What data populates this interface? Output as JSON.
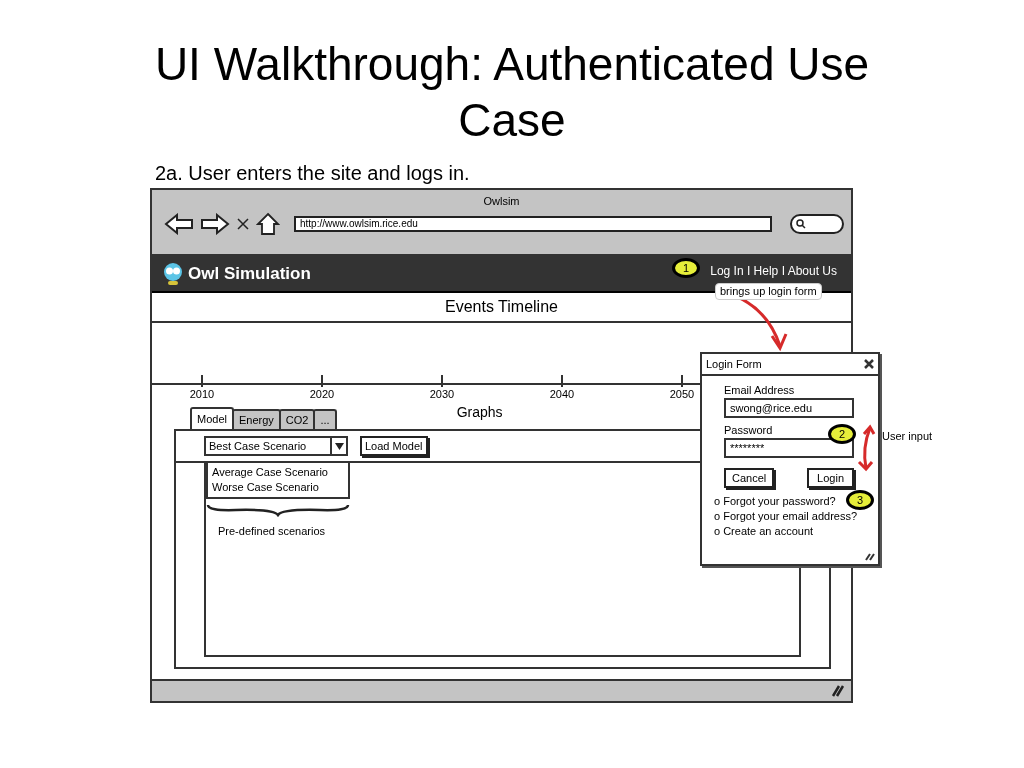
{
  "slide": {
    "title": "UI Walkthrough: Authenticated Use Case",
    "caption": "2a. User enters the site and logs in."
  },
  "browser": {
    "title": "Owlsim",
    "url": "http://www.owlsim.rice.edu"
  },
  "site": {
    "name": "Owl Simulation",
    "header_links": "Log In I Help I About Us"
  },
  "timeline": {
    "title": "Events Timeline",
    "ticks": [
      "2010",
      "2020",
      "2030",
      "2040",
      "2050"
    ]
  },
  "graphs": {
    "title": "Graphs",
    "tabs": [
      {
        "label": "Model",
        "selected": true
      },
      {
        "label": "Energy",
        "selected": false
      },
      {
        "label": "CO2",
        "selected": false
      },
      {
        "label": "...",
        "selected": false
      }
    ],
    "scenario_select": {
      "value": "Best Case Scenario",
      "expanded": true,
      "options": [
        "Average Case Scenario",
        "Worse Case Scenario"
      ]
    },
    "load_button": "Load Model",
    "brace_label": "Pre-defined scenarios"
  },
  "login_form": {
    "title": "Login Form",
    "email_label": "Email Address",
    "email_value": "swong@rice.edu",
    "password_label": "Password",
    "password_value": "********",
    "cancel_button": "Cancel",
    "login_button": "Login",
    "links": [
      "o Forgot your password?",
      "o Forgot your email address?",
      "o Create an account"
    ]
  },
  "annotations": {
    "markers": [
      "1",
      "2",
      "3"
    ],
    "login_hint": "brings up login form",
    "input_hint": "User input"
  }
}
